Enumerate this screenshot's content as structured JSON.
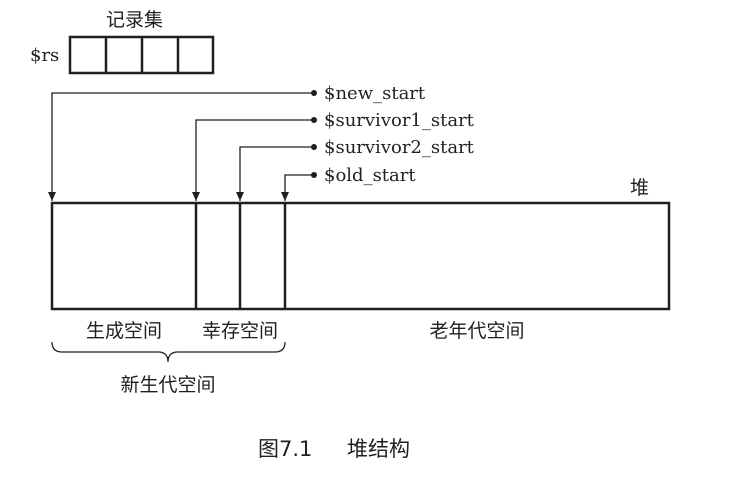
{
  "record_set": {
    "title": "记录集",
    "var_label": "$rs",
    "cell_count": 4
  },
  "pointers": [
    {
      "label": "$new_start"
    },
    {
      "label": "$survivor1_start"
    },
    {
      "label": "$survivor2_start"
    },
    {
      "label": "$old_start"
    }
  ],
  "heap": {
    "label": "堆"
  },
  "regions": [
    {
      "label": "生成空间"
    },
    {
      "label": "幸存空间"
    },
    {
      "label": "老年代空间"
    }
  ],
  "new_generation": {
    "label": "新生代空间"
  },
  "caption": {
    "number": "图7.1",
    "title": "堆结构"
  },
  "colors": {
    "stroke": "#231f20",
    "background": "#ffffff"
  }
}
